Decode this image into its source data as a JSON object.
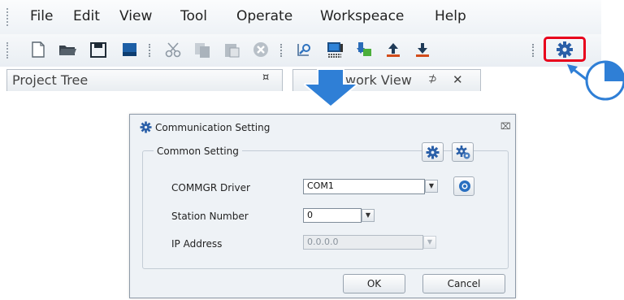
{
  "menu": {
    "file": "File",
    "edit": "Edit",
    "view": "View",
    "tool": "Tool",
    "operate": "Operate",
    "workspace": "Workspeace",
    "help": "Help"
  },
  "toolbar": {
    "icons": [
      "new-file-icon",
      "open-folder-icon",
      "save-icon",
      "save-all-icon",
      "cut-icon",
      "copy-icon",
      "paste-icon",
      "delete-icon",
      "search-device-icon",
      "monitor-icon",
      "download-icon",
      "upload-icon",
      "import-icon",
      "communication-setting-icon"
    ]
  },
  "panels": {
    "project_tree": "Project Tree",
    "project_tree_pin": "¤",
    "network_view": "work View",
    "network_view_pin": "⊅",
    "network_view_close": "✕"
  },
  "dialog": {
    "title": "Communication Setting",
    "close": "⌧",
    "group_title": "Common Setting",
    "commgr_label": "COMMGR Driver",
    "commgr_value": "COM1",
    "station_label": "Station Number",
    "station_value": "0",
    "ip_label": "IP Address",
    "ip_value": "0.0.0.0",
    "ok": "OK",
    "cancel": "Cancel"
  },
  "colors": {
    "highlight_red": "#e8001c",
    "callout_blue": "#2f7fd6",
    "gear_blue": "#2a5fa8"
  }
}
